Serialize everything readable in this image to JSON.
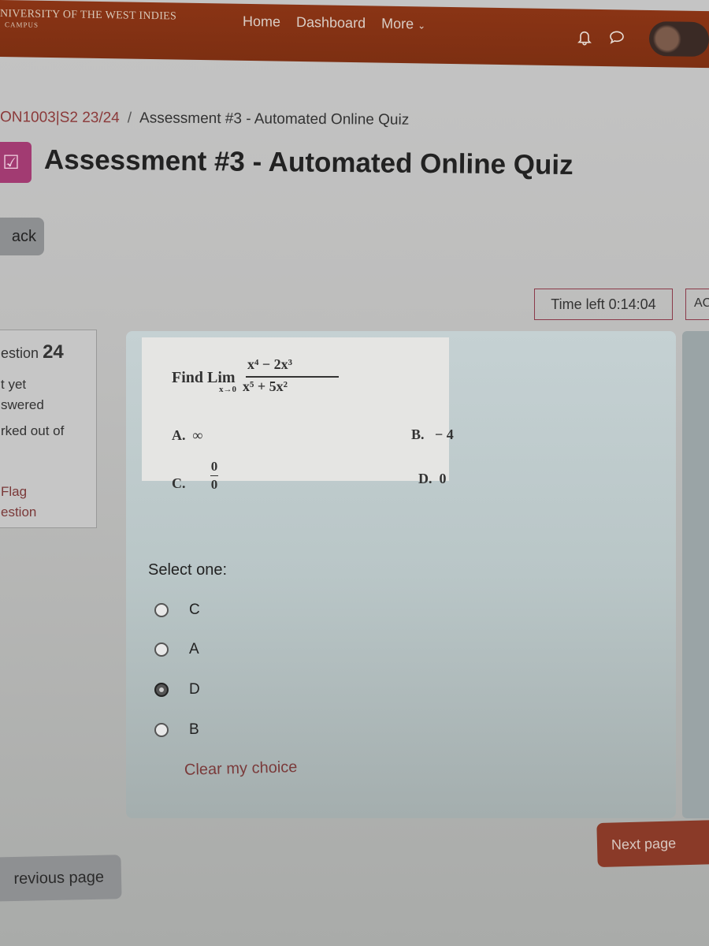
{
  "header": {
    "brand_line1": "NIVERSITY OF THE WEST INDIES",
    "brand_line2": "CAMPUS",
    "nav": [
      "Home",
      "Dashboard",
      "More"
    ],
    "icons": [
      "bell-icon",
      "chat-icon",
      "avatar"
    ]
  },
  "breadcrumb": {
    "course": "ON1003|S2 23/24",
    "separator": "/",
    "current": "Assessment #3 - Automated Online Quiz"
  },
  "page_title": "Assessment #3 - Automated Online Quiz",
  "back_label": "ack",
  "timer": {
    "label": "Time left 0:14:04",
    "partial": "AC"
  },
  "question_info": {
    "question_word": "estion",
    "question_number": "24",
    "state_line1": "t yet",
    "state_line2": "swered",
    "marks": "rked out of",
    "flag_line1": "Flag",
    "flag_line2": "estion"
  },
  "question": {
    "find": "Find",
    "lim": "Lim",
    "lim_sub": "x→0",
    "numerator": "x⁴ − 2x³",
    "denominator": "x⁵ + 5x²",
    "options": [
      {
        "letter": "A.",
        "value": "∞"
      },
      {
        "letter": "B.",
        "value": "− 4"
      },
      {
        "letter": "C.",
        "value_num": "0",
        "value_den": "0"
      },
      {
        "letter": "D.",
        "value": "0"
      }
    ]
  },
  "answer": {
    "prompt": "Select one:",
    "choices": [
      {
        "label": "C",
        "selected": false
      },
      {
        "label": "A",
        "selected": false
      },
      {
        "label": "D",
        "selected": true
      },
      {
        "label": "B",
        "selected": false
      }
    ],
    "clear_label": "Clear my choice"
  },
  "navigation": {
    "next_label": "Next page",
    "prev_label": "revious page"
  }
}
